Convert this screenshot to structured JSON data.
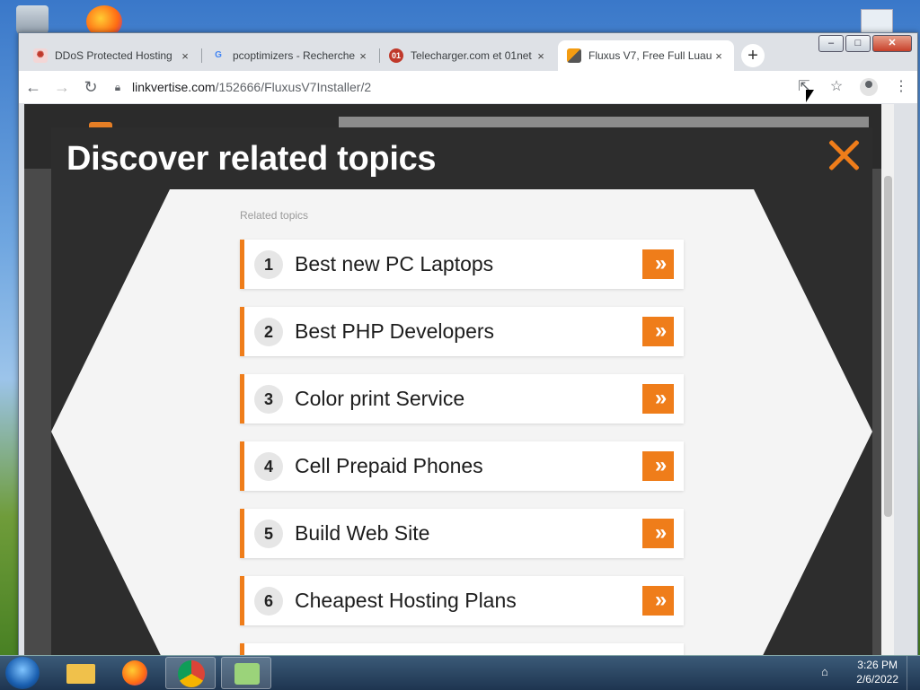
{
  "browser": {
    "tabs": [
      {
        "title": "DDoS Protected Hosting",
        "favicon": "ddos-favicon",
        "active": false
      },
      {
        "title": "pcoptimizers - Recherche",
        "favicon": "google-favicon",
        "favicon_glyph": "G",
        "active": false
      },
      {
        "title": "Telecharger.com et 01net",
        "favicon": "01net-favicon",
        "favicon_glyph": "01",
        "active": false
      },
      {
        "title": "Fluxus V7, Free Full Luau",
        "favicon": "fluxus-favicon",
        "active": true
      }
    ],
    "close_glyph": "×",
    "newtab_glyph": "+",
    "url_host": "linkvertise.com",
    "url_path": "/152666/FluxusV7Installer/2",
    "window_controls": {
      "minimize": "–",
      "maximize": "□",
      "close": "✕"
    }
  },
  "modal": {
    "title": "Discover related topics",
    "related_label": "Related topics",
    "go_glyph": "»",
    "topics": [
      {
        "num": "1",
        "label": "Best new PC Laptops"
      },
      {
        "num": "2",
        "label": "Best PHP Developers"
      },
      {
        "num": "3",
        "label": "Color print Service"
      },
      {
        "num": "4",
        "label": "Cell Prepaid Phones"
      },
      {
        "num": "5",
        "label": "Build Web Site"
      },
      {
        "num": "6",
        "label": "Cheapest Hosting Plans"
      }
    ],
    "accent": "#ef7d1a",
    "header_bg": "#2d2d2d"
  },
  "taskbar": {
    "time": "3:26 PM",
    "date": "2/6/2022"
  }
}
